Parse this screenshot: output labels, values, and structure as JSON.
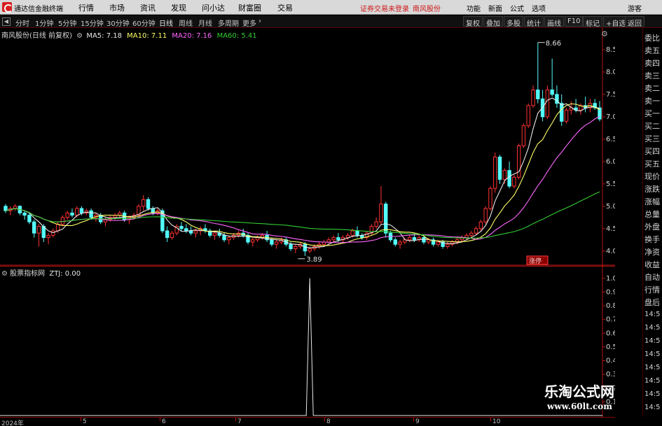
{
  "app": {
    "name": "通达信金融终端",
    "menus": [
      "行情",
      "市场",
      "资讯",
      "发现",
      "问小达",
      "财富圈",
      "交易"
    ],
    "notice": "证券交易未登录",
    "stock_tag": "南风股份",
    "right_menus": [
      "功能",
      "新面",
      "公式",
      "选项"
    ],
    "guest": "游客"
  },
  "toolbar": {
    "periods": [
      "分时",
      "1分钟",
      "5分钟",
      "15分钟",
      "30分钟",
      "60分钟",
      "日线",
      "周线",
      "月线",
      "多周期",
      "更多"
    ],
    "active": "日线",
    "right_buttons": [
      "复权",
      "叠加",
      "多股",
      "统计",
      "画线",
      "F10",
      "标记",
      "+自选",
      "返回"
    ]
  },
  "legend": {
    "title": "南风股份(日线 前复权)",
    "ma5": "MA5: 7.18",
    "ma10": "MA10: 7.11",
    "ma20": "MA20: 7.16",
    "ma60": "MA60: 5.41"
  },
  "indicator": {
    "name": "股票指标网",
    "value": "ZTJ: 0.00"
  },
  "annotations": {
    "high": "8.66",
    "low": "3.89",
    "tag": "涨停"
  },
  "side_panel": {
    "labels": [
      "委比",
      "卖五",
      "卖四",
      "卖三",
      "卖二",
      "卖一",
      "买一",
      "买二",
      "买三",
      "买四",
      "买五",
      "现价",
      "涨跌",
      "涨幅",
      "总量",
      "外盘",
      "换手",
      "净资",
      "收益",
      "自动",
      "行情",
      "盘后"
    ],
    "times": [
      "14:5",
      "14:5",
      "14:5",
      "14:5",
      "14:5",
      "14:5",
      "14:5",
      "14:5"
    ]
  },
  "watermark": {
    "line1": "乐淘公式网",
    "line2": "www.60lt.com"
  },
  "chart_data": [
    {
      "type": "candlestick",
      "title": "南风股份(日线 前复权)",
      "ylim": [
        3.7,
        8.75
      ],
      "yticks": [
        4.0,
        4.5,
        5.0,
        5.5,
        6.0,
        6.5,
        7.0,
        7.5,
        8.0,
        8.5
      ],
      "xlabels": [
        "2024年",
        "5",
        "6",
        "7",
        "8",
        "9",
        "10"
      ],
      "candles": [
        [
          5.0,
          5.05,
          4.85,
          4.9
        ],
        [
          4.9,
          5.0,
          4.8,
          4.95
        ],
        [
          4.95,
          5.05,
          4.9,
          5.0
        ],
        [
          5.0,
          5.02,
          4.8,
          4.85
        ],
        [
          4.85,
          4.9,
          4.7,
          4.8
        ],
        [
          4.8,
          4.85,
          4.6,
          4.65
        ],
        [
          4.65,
          4.7,
          4.3,
          4.4
        ],
        [
          4.4,
          4.6,
          4.1,
          4.55
        ],
        [
          4.55,
          4.6,
          4.2,
          4.3
        ],
        [
          4.3,
          4.4,
          4.15,
          4.35
        ],
        [
          4.35,
          4.5,
          4.3,
          4.45
        ],
        [
          4.45,
          4.65,
          4.4,
          4.6
        ],
        [
          4.6,
          4.8,
          4.55,
          4.75
        ],
        [
          4.75,
          4.9,
          4.7,
          4.85
        ],
        [
          4.85,
          4.95,
          4.75,
          4.8
        ],
        [
          4.8,
          5.0,
          4.75,
          4.95
        ],
        [
          4.95,
          5.0,
          4.8,
          4.85
        ],
        [
          4.85,
          4.95,
          4.8,
          4.9
        ],
        [
          4.9,
          4.95,
          4.7,
          4.75
        ],
        [
          4.75,
          4.85,
          4.65,
          4.8
        ],
        [
          4.8,
          4.85,
          4.6,
          4.65
        ],
        [
          4.65,
          4.75,
          4.55,
          4.7
        ],
        [
          4.7,
          4.8,
          4.65,
          4.75
        ],
        [
          4.75,
          4.85,
          4.7,
          4.8
        ],
        [
          4.8,
          4.9,
          4.75,
          4.85
        ],
        [
          4.85,
          4.9,
          4.65,
          4.7
        ],
        [
          4.7,
          4.8,
          4.6,
          4.75
        ],
        [
          4.75,
          4.85,
          4.7,
          4.8
        ],
        [
          4.8,
          5.05,
          4.75,
          5.0
        ],
        [
          5.0,
          5.25,
          4.9,
          5.15
        ],
        [
          5.15,
          5.2,
          4.9,
          4.95
        ],
        [
          4.95,
          5.0,
          4.8,
          4.85
        ],
        [
          4.85,
          4.95,
          4.8,
          4.9
        ],
        [
          4.9,
          4.95,
          4.4,
          4.45
        ],
        [
          4.45,
          4.55,
          4.2,
          4.3
        ],
        [
          4.3,
          4.45,
          4.25,
          4.4
        ],
        [
          4.4,
          4.6,
          4.35,
          4.55
        ],
        [
          4.55,
          4.65,
          4.45,
          4.5
        ],
        [
          4.5,
          4.6,
          4.4,
          4.45
        ],
        [
          4.45,
          4.55,
          4.35,
          4.4
        ],
        [
          4.4,
          4.5,
          4.3,
          4.45
        ],
        [
          4.45,
          4.55,
          4.35,
          4.5
        ],
        [
          4.5,
          4.6,
          4.4,
          4.45
        ],
        [
          4.45,
          4.5,
          4.3,
          4.35
        ],
        [
          4.35,
          4.45,
          4.25,
          4.4
        ],
        [
          4.4,
          4.5,
          4.3,
          4.35
        ],
        [
          4.35,
          4.4,
          4.2,
          4.25
        ],
        [
          4.25,
          4.35,
          4.15,
          4.3
        ],
        [
          4.3,
          4.4,
          4.25,
          4.35
        ],
        [
          4.35,
          4.45,
          4.3,
          4.4
        ],
        [
          4.4,
          4.5,
          4.3,
          4.35
        ],
        [
          4.35,
          4.4,
          4.15,
          4.2
        ],
        [
          4.2,
          4.3,
          4.1,
          4.25
        ],
        [
          4.25,
          4.35,
          4.2,
          4.3
        ],
        [
          4.3,
          4.4,
          4.25,
          4.35
        ],
        [
          4.35,
          4.45,
          4.2,
          4.25
        ],
        [
          4.25,
          4.3,
          4.1,
          4.15
        ],
        [
          4.15,
          4.25,
          4.05,
          4.2
        ],
        [
          4.2,
          4.3,
          4.15,
          4.25
        ],
        [
          4.25,
          4.3,
          4.1,
          4.15
        ],
        [
          4.15,
          4.2,
          4.0,
          4.05
        ],
        [
          4.05,
          4.15,
          3.95,
          4.1
        ],
        [
          4.1,
          4.2,
          4.05,
          4.15
        ],
        [
          4.15,
          4.2,
          3.89,
          4.0
        ],
        [
          4.0,
          4.1,
          3.95,
          4.05
        ],
        [
          4.05,
          4.15,
          4.0,
          4.1
        ],
        [
          4.1,
          4.2,
          4.05,
          4.15
        ],
        [
          4.15,
          4.25,
          4.1,
          4.2
        ],
        [
          4.2,
          4.3,
          4.15,
          4.25
        ],
        [
          4.25,
          4.35,
          4.2,
          4.3
        ],
        [
          4.3,
          4.4,
          4.2,
          4.25
        ],
        [
          4.25,
          4.35,
          4.2,
          4.3
        ],
        [
          4.3,
          4.4,
          4.25,
          4.35
        ],
        [
          4.35,
          4.5,
          4.3,
          4.45
        ],
        [
          4.45,
          4.55,
          4.3,
          4.35
        ],
        [
          4.35,
          4.4,
          4.25,
          4.3
        ],
        [
          4.3,
          4.45,
          4.25,
          4.4
        ],
        [
          4.4,
          4.6,
          4.35,
          4.55
        ],
        [
          4.55,
          4.75,
          4.5,
          4.65
        ],
        [
          4.65,
          5.45,
          4.6,
          5.05
        ],
        [
          5.05,
          5.1,
          4.3,
          4.4
        ],
        [
          4.4,
          4.45,
          4.2,
          4.25
        ],
        [
          4.25,
          4.3,
          4.1,
          4.15
        ],
        [
          4.15,
          4.25,
          4.05,
          4.2
        ],
        [
          4.2,
          4.3,
          4.15,
          4.25
        ],
        [
          4.25,
          4.35,
          4.2,
          4.3
        ],
        [
          4.3,
          4.4,
          4.2,
          4.25
        ],
        [
          4.25,
          4.35,
          4.2,
          4.3
        ],
        [
          4.3,
          4.35,
          4.15,
          4.2
        ],
        [
          4.2,
          4.3,
          4.15,
          4.25
        ],
        [
          4.25,
          4.3,
          4.1,
          4.15
        ],
        [
          4.15,
          4.25,
          4.1,
          4.2
        ],
        [
          4.2,
          4.25,
          4.05,
          4.1
        ],
        [
          4.1,
          4.2,
          4.05,
          4.15
        ],
        [
          4.15,
          4.25,
          4.1,
          4.2
        ],
        [
          4.2,
          4.3,
          4.15,
          4.25
        ],
        [
          4.25,
          4.35,
          4.2,
          4.3
        ],
        [
          4.3,
          4.4,
          4.25,
          4.35
        ],
        [
          4.35,
          4.45,
          4.3,
          4.4
        ],
        [
          4.4,
          4.55,
          4.35,
          4.5
        ],
        [
          4.5,
          4.7,
          4.45,
          4.65
        ],
        [
          4.65,
          5.0,
          4.6,
          4.95
        ],
        [
          4.95,
          5.45,
          4.9,
          5.4
        ],
        [
          5.4,
          6.2,
          5.3,
          6.1
        ],
        [
          6.1,
          6.15,
          5.5,
          5.6
        ],
        [
          5.6,
          5.85,
          5.5,
          5.8
        ],
        [
          5.8,
          6.0,
          5.4,
          5.45
        ],
        [
          5.45,
          5.7,
          5.4,
          5.65
        ],
        [
          5.65,
          6.4,
          5.6,
          6.35
        ],
        [
          6.35,
          6.85,
          6.3,
          6.8
        ],
        [
          6.8,
          7.3,
          6.75,
          7.25
        ],
        [
          7.25,
          7.7,
          7.2,
          7.6
        ],
        [
          7.6,
          8.66,
          7.3,
          7.4
        ],
        [
          7.4,
          7.6,
          6.9,
          7.0
        ],
        [
          7.0,
          7.7,
          6.95,
          7.6
        ],
        [
          7.6,
          8.3,
          7.45,
          7.5
        ],
        [
          7.5,
          7.7,
          7.2,
          7.3
        ],
        [
          7.3,
          7.5,
          6.8,
          6.9
        ],
        [
          6.9,
          7.2,
          6.85,
          7.15
        ],
        [
          7.15,
          7.35,
          7.05,
          7.2
        ],
        [
          7.2,
          7.4,
          7.1,
          7.15
        ],
        [
          7.15,
          7.3,
          7.05,
          7.25
        ],
        [
          7.25,
          7.45,
          7.1,
          7.2
        ],
        [
          7.2,
          7.4,
          7.1,
          7.3
        ],
        [
          7.3,
          7.4,
          7.15,
          7.2
        ],
        [
          7.2,
          7.35,
          6.9,
          6.95
        ]
      ]
    },
    {
      "type": "line",
      "title": "股票指标网",
      "series_label": "ZTJ",
      "ylim": [
        0,
        1.05
      ],
      "yticks": [
        1.0,
        0.9,
        0.8,
        0.7,
        0.6,
        0.5,
        0.4,
        0.3,
        0.2,
        0.1
      ],
      "spike_index": 64,
      "spike_value": 1.0
    }
  ],
  "colors": {
    "up": "#ff3232",
    "down": "#54fcfc",
    "ma5": "#e8e8e8",
    "ma10": "#ffff66",
    "ma20": "#ff66ff",
    "ma60": "#33cc33",
    "grid": "#7a0000",
    "axis": "#b41414"
  }
}
